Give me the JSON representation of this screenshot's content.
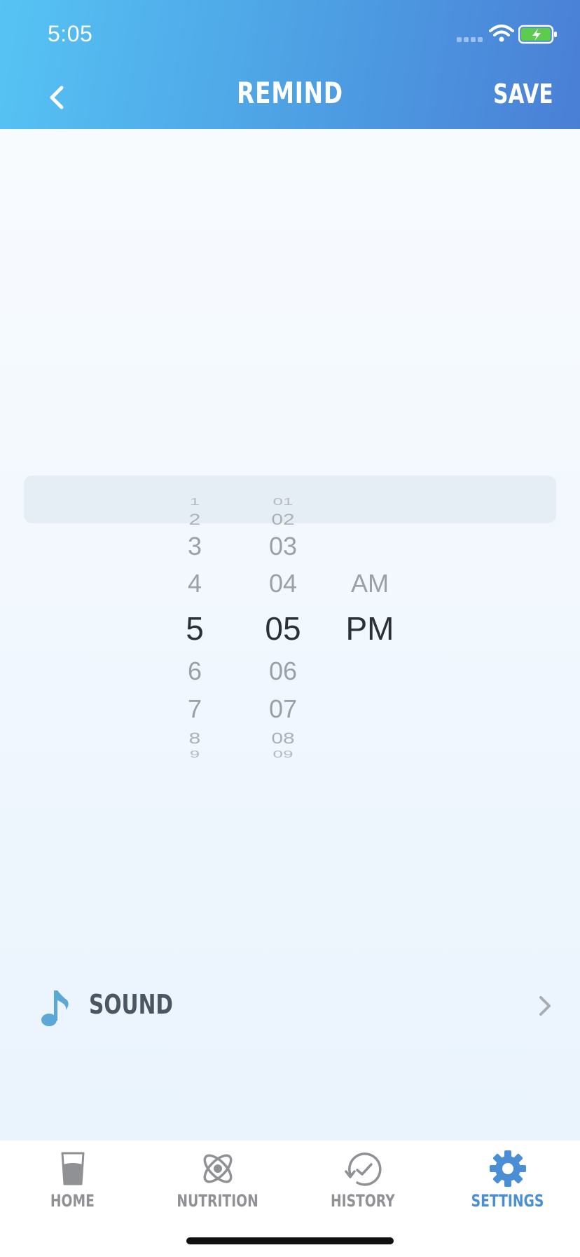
{
  "status_bar": {
    "time": "5:05"
  },
  "header": {
    "title": "REMIND",
    "save_label": "SAVE"
  },
  "picker": {
    "hours": [
      "1",
      "2",
      "3",
      "4",
      "5",
      "6",
      "7",
      "8",
      "9"
    ],
    "selected_hour": "5",
    "minutes": [
      "01",
      "02",
      "03",
      "04",
      "05",
      "06",
      "07",
      "08",
      "09"
    ],
    "selected_minute": "05",
    "periods": [
      "AM",
      "PM"
    ],
    "selected_period": "PM"
  },
  "sound": {
    "label": "SOUND"
  },
  "tabs": [
    {
      "label": "HOME",
      "icon": "glass-icon",
      "active": false
    },
    {
      "label": "NUTRITION",
      "icon": "atom-icon",
      "active": false
    },
    {
      "label": "HISTORY",
      "icon": "history-icon",
      "active": false
    },
    {
      "label": "SETTINGS",
      "icon": "gear-icon",
      "active": true
    }
  ],
  "colors": {
    "accent": "#4a8fd6",
    "header_start": "#56c3f4",
    "header_end": "#4a7fd6",
    "battery_green": "#5ccb4e"
  }
}
